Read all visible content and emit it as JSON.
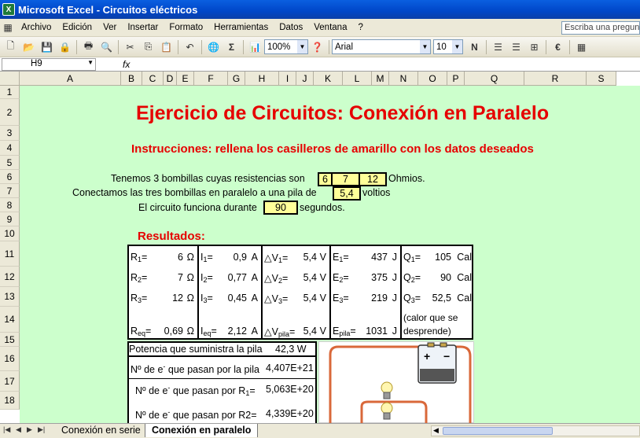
{
  "window": {
    "title": "Microsoft Excel - Circuitos eléctricos"
  },
  "menu": {
    "items": [
      "Archivo",
      "Edición",
      "Ver",
      "Insertar",
      "Formato",
      "Herramientas",
      "Datos",
      "Ventana",
      "?"
    ],
    "ask_placeholder": "Escriba una pregunta"
  },
  "toolbar": {
    "zoom": "100%",
    "font": "Arial",
    "size": "10",
    "bold": "N"
  },
  "formula": {
    "cell": "H9",
    "fx": "fx"
  },
  "columns": [
    "A",
    "B",
    "C",
    "D",
    "E",
    "F",
    "G",
    "H",
    "I",
    "J",
    "K",
    "L",
    "M",
    "N",
    "O",
    "P",
    "Q",
    "R",
    "S"
  ],
  "rows": [
    "1",
    "2",
    "3",
    "4",
    "5",
    "6",
    "7",
    "8",
    "9",
    "10",
    "11",
    "12",
    "13",
    "14",
    "15",
    "16",
    "17",
    "18"
  ],
  "sheet": {
    "title": "Ejercicio de Circuitos: Conexión en Paralelo",
    "instructions": "Instrucciones: rellena los casilleros de amarillo con los datos deseados",
    "line1": "Tenemos 3 bombillas cuyas resistencias son",
    "r1": "6",
    "r2": "7",
    "r3": "12",
    "ohms": "Ohmios.",
    "line2": "Conectamos las tres bombillas en paralelo a una pila de",
    "voltage": "5,4",
    "volts": "voltios",
    "line3": "El circuito funciona durante",
    "time": "90",
    "seconds": "segundos.",
    "results_label": "Resultados:",
    "R": {
      "r1": "6",
      "r2": "7",
      "r3": "12",
      "req": "0,69",
      "unit": "Ω"
    },
    "I": {
      "i1": "0,9",
      "i2": "0,77",
      "i3": "0,45",
      "ieq": "2,12",
      "unit": "A"
    },
    "V": {
      "v1": "5,4",
      "v2": "5,4",
      "v3": "5,4",
      "vpila": "5,4",
      "unit": "V"
    },
    "E": {
      "e1": "437",
      "e2": "375",
      "e3": "219",
      "epila": "1031",
      "unit": "J"
    },
    "Q": {
      "q1": "105",
      "q2": "90",
      "q3": "52,5",
      "unit": "Cal",
      "note": "(calor que se",
      "note2": "desprende)"
    },
    "power_label": "Potencia que suministra la pila",
    "power_value": "42,3 W",
    "electrons_pila_label": "Nº de e  que pasan por la pila",
    "electrons_pila": "4,407E+21",
    "electrons_r1_label": "Nº de e  que pasan por R",
    "electrons_r1": "5,063E+20",
    "electrons_r2_label": "Nº de e  que pasan por R2=",
    "electrons_r2": "4,339E+20"
  },
  "tabs": {
    "tab1": "Conexión en serie",
    "tab2": "Conexión en paralelo"
  }
}
